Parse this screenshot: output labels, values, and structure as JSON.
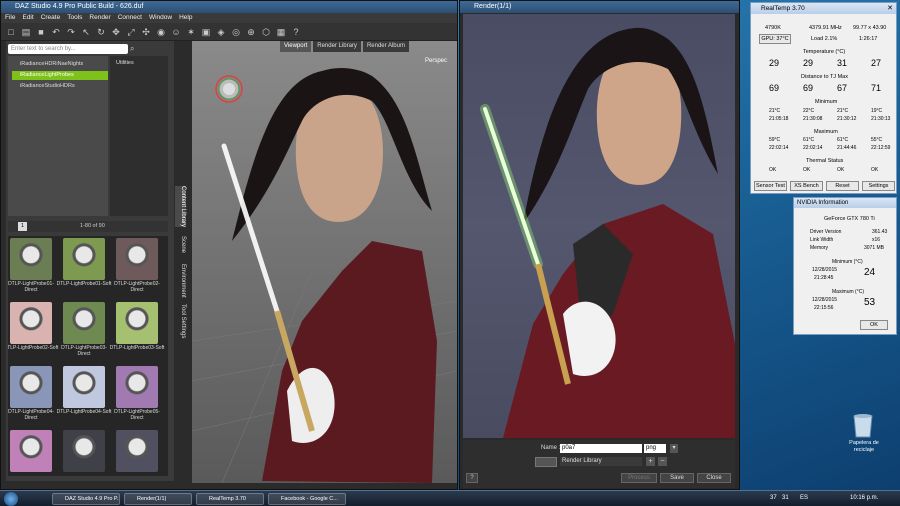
{
  "daz": {
    "title": "DAZ Studio 4.9 Pro Public Build - 626.duf",
    "menu": [
      "File",
      "Edit",
      "Create",
      "Tools",
      "Render",
      "Connect",
      "Window",
      "Help"
    ],
    "search_placeholder": "Enter text to search by...",
    "tree": [
      "iRadianceHDRiNaeNights",
      "iRadianceLightProbes",
      "iRadianceStudioHDRs"
    ],
    "folders": [
      "Utilities"
    ],
    "pager": "1-80 of 90",
    "page_num": "1",
    "vtabs": [
      "Content Library",
      "Scene",
      "Environment",
      "Tool Settings"
    ],
    "thumbs": [
      {
        "label": "DTLP-LightProbe01-Direct",
        "color": "#6b7d52"
      },
      {
        "label": "DTLP-LightProbe01-Soft",
        "color": "#7e9a50"
      },
      {
        "label": "DTLP-LightProbe02-Direct",
        "color": "#6e5a5a"
      },
      {
        "label": "DTLP-LightProbe02-Soft",
        "color": "#d9b3b0"
      },
      {
        "label": "DTLP-LightProbe03-Direct",
        "color": "#6f8a50"
      },
      {
        "label": "DTLP-LightProbe03-Soft",
        "color": "#a4c070"
      },
      {
        "label": "DTLP-LightProbe04-Direct",
        "color": "#8a96b8"
      },
      {
        "label": "DTLP-LightProbe04-Soft",
        "color": "#c0c8e0"
      },
      {
        "label": "DTLP-LightProbe05-Direct",
        "color": "#a07ab0"
      },
      {
        "label": "",
        "color": "#c080b8"
      },
      {
        "label": "",
        "color": "#404048"
      },
      {
        "label": "",
        "color": "#505060"
      }
    ],
    "viewport_tabs": [
      "Viewport",
      "Render Library",
      "Render Album"
    ],
    "perspective_label": "Perspec"
  },
  "render": {
    "title": "Render(1/1)",
    "name_label": "Name :",
    "name_value": "p0a7",
    "format": "png",
    "destination": "Render Library",
    "buttons": [
      "Save",
      "Close"
    ],
    "disabled_button": "Process"
  },
  "realtemp": {
    "title": "RealTemp 3.70",
    "cpu_code": "4790K",
    "mhz": "4379.91 MHz",
    "multiplier": "99.77 x 43.90",
    "gpu_button": "GPU: 37°C",
    "load": "Load   2.1%",
    "uptime": "1:26:17",
    "temp_label": "Temperature (°C)",
    "temps": [
      "29",
      "29",
      "31",
      "27"
    ],
    "tj_label": "Distance to TJ Max",
    "tj": [
      "69",
      "69",
      "67",
      "71"
    ],
    "min_label": "Minimum",
    "min_temps": [
      "21°C",
      "22°C",
      "21°C",
      "19°C"
    ],
    "min_times": [
      "21:05:18",
      "21:30:08",
      "21:30:12",
      "21:30:13"
    ],
    "max_label": "Maximum",
    "max_temps": [
      "59°C",
      "61°C",
      "61°C",
      "55°C"
    ],
    "max_times": [
      "22:02:14",
      "22:02:14",
      "21:44:46",
      "22:12:59"
    ],
    "thermal_label": "Thermal Status",
    "thermal": [
      "OK",
      "OK",
      "OK",
      "OK"
    ],
    "buttons": [
      "Sensor Test",
      "XS Bench",
      "Reset",
      "Settings"
    ]
  },
  "nvidia": {
    "title": "NVIDIA Information",
    "gpu": "GeForce GTX 780 Ti",
    "rows": [
      {
        "k": "Driver Version",
        "v": "361.43"
      },
      {
        "k": "Link Width",
        "v": "x16"
      },
      {
        "k": "Memory",
        "v": "3071 MB"
      }
    ],
    "min_label": "Minimum (°C)",
    "min_date": "12/28/2015",
    "min_time": "21:28:45",
    "min_val": "24",
    "max_label": "Maximum (°C)",
    "max_date": "12/28/2015",
    "max_time": "22:15:56",
    "max_val": "53",
    "ok": "OK"
  },
  "desktop": {
    "recycle_label": "Papelera de reciclaje"
  },
  "taskbar": {
    "items": [
      "DAZ Studio 4.9 Pro P...",
      "Render(1/1)",
      "RealTemp 3.70",
      "Facebook - Google C..."
    ],
    "tray_temps": [
      "37",
      "31"
    ],
    "lang": "ES",
    "time": "10:16 p.m."
  }
}
